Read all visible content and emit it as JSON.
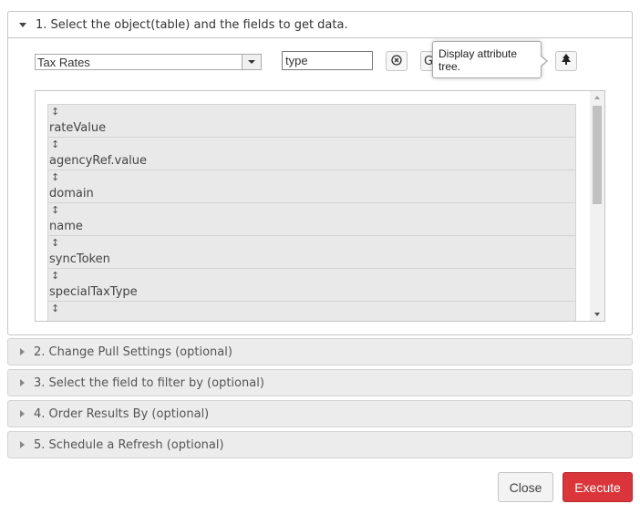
{
  "step1": {
    "title": "1. Select the object(table) and the fields to get data.",
    "object_select": {
      "value": "Tax Rates"
    },
    "field_search": {
      "value": "type"
    },
    "tooltip": {
      "line1": "Display attribute",
      "line2": "tree."
    },
    "fields": [
      {
        "handle": "↕",
        "name": "rateValue"
      },
      {
        "handle": "↕",
        "name": "agencyRef.value"
      },
      {
        "handle": "↕",
        "name": "domain"
      },
      {
        "handle": "↕",
        "name": "name"
      },
      {
        "handle": "↕",
        "name": "syncToken"
      },
      {
        "handle": "↕",
        "name": "specialTaxType"
      },
      {
        "handle": "↕",
        "name": ""
      }
    ]
  },
  "sections": [
    "2. Change Pull Settings (optional)",
    "3. Select the field to filter by (optional)",
    "4. Order Results By (optional)",
    "5. Schedule a Refresh (optional)"
  ],
  "buttons": {
    "close": "Close",
    "execute": "Execute"
  },
  "colors": {
    "execute": "#d9353a",
    "section_bg": "#ececec",
    "field_bg": "#e9e9e9"
  }
}
